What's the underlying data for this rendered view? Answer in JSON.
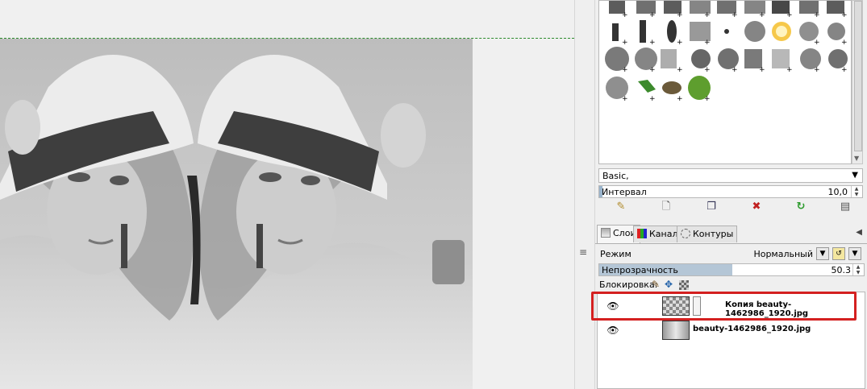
{
  "brushes": {
    "preset": "Basic,",
    "interval_label": "Интервал",
    "interval_value": "10,0"
  },
  "layers_dock": {
    "tabs": [
      {
        "label": "Слои",
        "icon": "layers-icon"
      },
      {
        "label": "Каналы",
        "icon": "channels-icon"
      },
      {
        "label": "Контуры",
        "icon": "paths-icon"
      }
    ],
    "mode_label": "Режим",
    "mode_value": "Нормальный",
    "opacity_label": "Непрозрачность",
    "opacity_value": "50.3",
    "opacity_fraction": 0.503,
    "lock_label": "Блокировка:",
    "layers": [
      {
        "name": "Копия beauty-1462986_1920.jpg",
        "visible": true,
        "selected": true
      },
      {
        "name": "beauty-1462986_1920.jpg",
        "visible": true,
        "selected": false
      }
    ]
  },
  "annotation_color": "#d42020",
  "guide_color": "#2b8a2b"
}
